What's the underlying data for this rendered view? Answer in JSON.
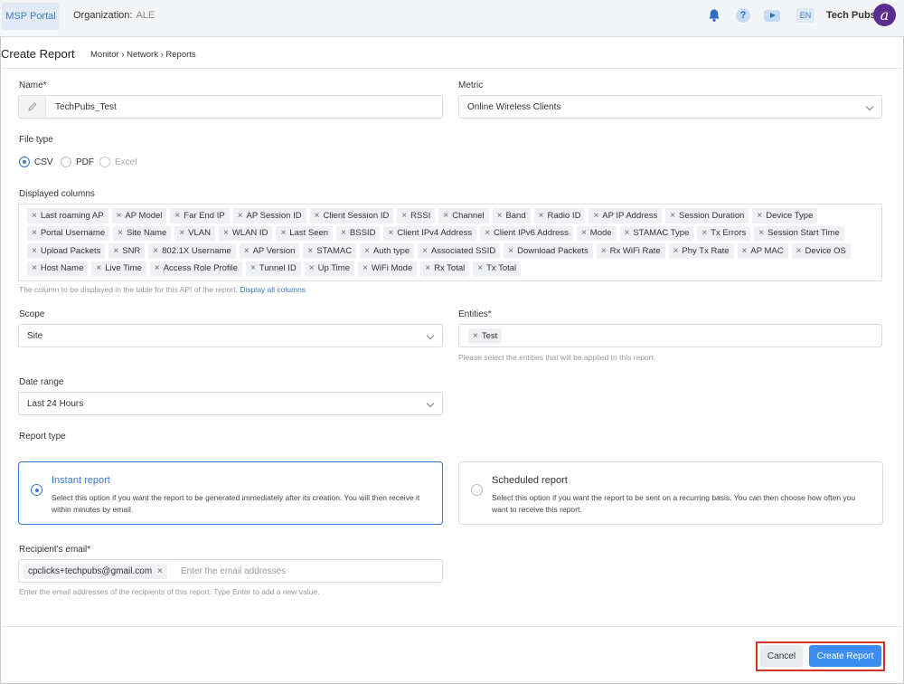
{
  "topbar": {
    "msp_label": "MSP Portal",
    "org_label": "Organization:",
    "org_value": "ALE",
    "lang": "EN",
    "user": "Tech Pubs",
    "help_glyph": "?",
    "logo_glyph": "a"
  },
  "header": {
    "title": "Create Report",
    "breadcrumb": "Monitor › Network › Reports"
  },
  "form": {
    "name_label": "Name*",
    "name_value": "TechPubs_Test",
    "metric_label": "Metric",
    "metric_value": "Online Wireless Clients",
    "filetype_label": "File type",
    "filetypes": [
      "CSV",
      "PDF",
      "Excel"
    ],
    "columns_label": "Displayed columns",
    "columns": [
      "Last roaming AP",
      "AP Model",
      "Far End IP",
      "AP Session ID",
      "Client Session ID",
      "RSSI",
      "Channel",
      "Band",
      "Radio ID",
      "AP IP Address",
      "Session Duration",
      "Device Type",
      "Portal Username",
      "Site Name",
      "VLAN",
      "WLAN ID",
      "Last Seen",
      "BSSID",
      "Client IPv4 Address",
      "Client IPv6 Address",
      "Mode",
      "STAMAC Type",
      "Tx Errors",
      "Session Start Time",
      "Upload Packets",
      "SNR",
      "802.1X Username",
      "AP Version",
      "STAMAC",
      "Auth type",
      "Associated SSID",
      "Download Packets",
      "Rx WiFi Rate",
      "Phy Tx Rate",
      "AP MAC",
      "Device OS",
      "Host Name",
      "Live Time",
      "Access Role Profile",
      "Tunnel ID",
      "Up Time",
      "WiFi Mode",
      "Rx Total",
      "Tx Total"
    ],
    "tag_remove_glyph": "×",
    "columns_hint": "The column to be displayed in the table for this API of the report.",
    "columns_link": "Display all columns",
    "scope_label": "Scope",
    "scope_value": "Site",
    "entities_label": "Entities*",
    "entity_tag": "Test",
    "entities_hint": "Please select the entities that will be applied to this report.",
    "daterange_label": "Date range",
    "daterange_value": "Last 24 Hours",
    "reporttype_label": "Report type",
    "instant_title": "Instant report",
    "instant_desc": "Select this option if you want the report to be generated immediately after its creation. You will then receive it within minutes by email.",
    "scheduled_title": "Scheduled report",
    "scheduled_desc": "Select this option if you want the report to be sent on a recurring basis. You can then choose how often you want to receive this report.",
    "email_label": "Recipient's email*",
    "email_chip": "cpclicks+techpubs@gmail.com",
    "email_placeholder": "Enter the email addresses",
    "email_hint": "Enter the email addresses of the recipients of this report. Type Enter to add a new value."
  },
  "footer": {
    "cancel": "Cancel",
    "create": "Create Report"
  },
  "colors": {
    "accent": "#3a78c3",
    "primary_button": "#3b8ef0",
    "highlight_outline": "#d9302c"
  }
}
